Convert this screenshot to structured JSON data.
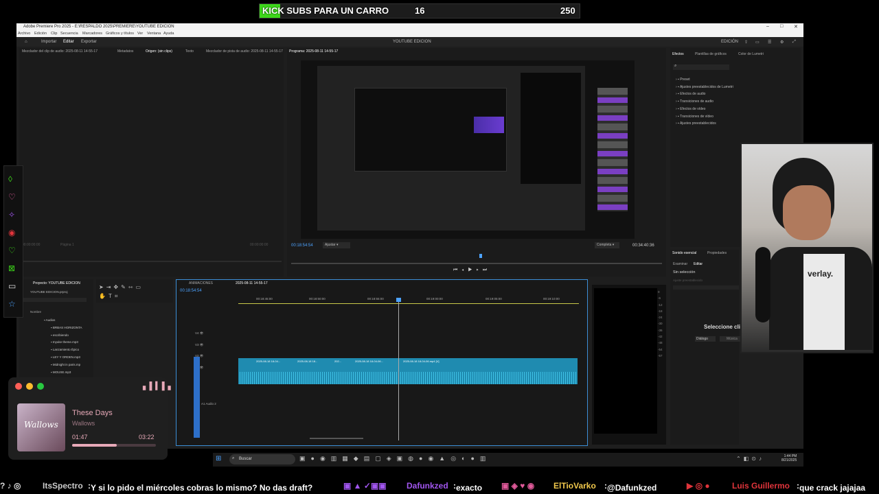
{
  "goal": {
    "label": "KICK SUBS PARA UN CARRO",
    "current": "16",
    "target": "250",
    "progress": 0.064
  },
  "window": {
    "title": "Adobe Premiere Pro 2025 - E:\\RESPALDO 2025\\PREMIERE\\YOUTUBE EDICION",
    "menu": [
      "Archivo",
      "Edición",
      "Clip",
      "Secuencia",
      "Marcadores",
      "Gráficos y títulos",
      "Ver",
      "Ventana",
      "Ayuda"
    ],
    "workspaces": [
      "Importar",
      "Editar",
      "Exportar"
    ],
    "center_title": "YOUTUBE EDICION",
    "right_label": "EDICIÓN"
  },
  "source_panel": {
    "tabs": [
      "Mezclador del clip de audio: 2025-08-11 14-55-17",
      "Metadatos",
      "Origen: (sin clips)",
      "Texto",
      "Mezclador de pista de audio: 2025-08-11 14-55-17"
    ],
    "tc_left": "00:00:00:00",
    "tc_right": "00:00:00:00",
    "fit": "Página 1"
  },
  "program": {
    "tab": "Programa: 2025-08-11 14-55-17",
    "tc": "00:18:54:54",
    "fit": "Ajustar",
    "quality": "Completa",
    "duration": "00:34:40:36"
  },
  "effects": {
    "tabs": [
      "Efectos",
      "Plantillas de gráficos",
      "Color de Lumetri"
    ],
    "items": [
      "Preset",
      "Ajustes preestablecidos de Lumetri",
      "Efectos de audio",
      "Transiciones de audio",
      "Efectos de vídeo",
      "Transiciones de vídeo",
      "Ajustes preestablecidos"
    ]
  },
  "essential": {
    "tabs": [
      "Sonido esencial",
      "Propiedades"
    ],
    "sub": [
      "Examinar",
      "Editar"
    ],
    "no_sel": "Sin selección",
    "preset": "Ajuste preestablecido",
    "select_msg": "Seleccione clips",
    "dialog": "Diálogo",
    "more": "Música"
  },
  "project": {
    "tab": "Proyecto: YOUTUBE EDICION",
    "file": "YOUTUBE EDICION.prproj",
    "col": "Nombre",
    "items": [
      "Audios",
      "BRBAS HORIZONTA",
      "escribiendo",
      "Inyuke theme.mp3",
      "Lanzamiento Épico",
      "LEY Y ORDEN.mp3",
      "Midnight in paris.mp",
      "MOUSE.mp3"
    ]
  },
  "timeline": {
    "tabs": [
      "ANIMACIONES",
      "2025-08-11 14-55-17"
    ],
    "tc": "00:18:54:54",
    "ruler": [
      "00:18:45:00",
      "00:18:50:00",
      "00:18:55:00",
      "00:19:00:00",
      "00:19:05:00",
      "00:19:10:00"
    ],
    "tracks": [
      "V4",
      "V3",
      "V2",
      "V1",
      "A1"
    ],
    "audio_track": "Audio 2",
    "clips": [
      "2025-08-18 18-04...",
      "2025-08-18 18...",
      "202...",
      "2025-08-18 18-04-06...",
      "2025-08-18 18-04-06.mp4 [V]"
    ]
  },
  "meter": {
    "scale": [
      "0",
      "-6",
      "-12",
      "-18",
      "-24",
      "-30",
      "-36",
      "-42",
      "-48",
      "-54",
      "-57"
    ]
  },
  "music": {
    "title": "These Days",
    "artist": "Wallows",
    "elapsed": "01:47",
    "total": "03:22",
    "progress": 0.53,
    "art_text": "Wallows"
  },
  "cam": {
    "shirt_text": "verlay."
  },
  "taskbar": {
    "search": "Buscar",
    "time": "1:44 PM",
    "date": "8/21/2025"
  },
  "ticker": [
    {
      "user": "ItsSpectro",
      "msg": "Y si lo pido el miércoles cobras lo mismo? No das draft?"
    },
    {
      "user": "Dafunkzed",
      "msg": "exacto"
    },
    {
      "user": "ElTioVarko",
      "msg": "@Dafunkzed"
    },
    {
      "user": "Luis Guillermo",
      "msg": "que crack jajajaa"
    }
  ],
  "colors": {
    "goal": "#3dd61a",
    "accent": "#3c8fd8",
    "clip": "#1f8bb0",
    "user_red": "#e0343b",
    "user_purple": "#a256f0",
    "user_yellow": "#f2c94c"
  }
}
